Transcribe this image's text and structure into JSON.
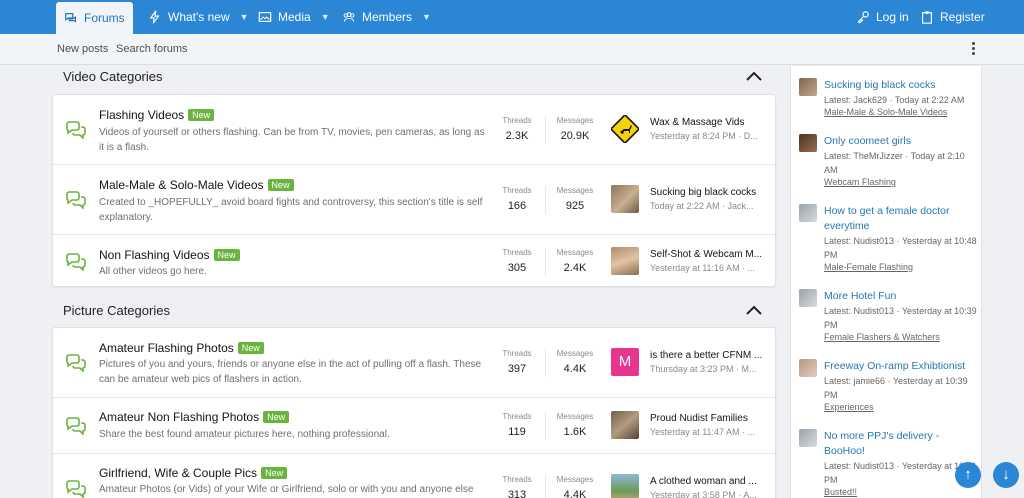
{
  "nav": {
    "forums": "Forums",
    "whats_new": "What's new",
    "media": "Media",
    "members": "Members",
    "login": "Log in",
    "register": "Register"
  },
  "subnav": {
    "new_posts": "New posts",
    "search_forums": "Search forums"
  },
  "categories": [
    {
      "title": "Video Categories",
      "nodes": [
        {
          "title": "Flashing Videos",
          "badge": "New",
          "desc": "Videos of yourself or others flashing. Can be from TV, movies, pen cameras, as long as it is a flash.",
          "threads_label": "Threads",
          "threads": "2.3K",
          "messages_label": "Messages",
          "messages": "20.9K",
          "last_title": "Wax & Massage Vids",
          "last_meta": "Yesterday at 8:24 PM · D..."
        },
        {
          "title": "Male-Male & Solo-Male Videos",
          "badge": "New",
          "desc": "Created to _HOPEFULLY_ avoid board fights and controversy, this section's title is self explanatory.",
          "threads_label": "Threads",
          "threads": "166",
          "messages_label": "Messages",
          "messages": "925",
          "last_title": "Sucking big black cocks",
          "last_meta": "Today at 2:22 AM · Jack..."
        },
        {
          "title": "Non Flashing Videos",
          "badge": "New",
          "desc": "All other videos go here.",
          "threads_label": "Threads",
          "threads": "305",
          "messages_label": "Messages",
          "messages": "2.4K",
          "last_title": "Self-Shot & Webcam M...",
          "last_meta": "Yesterday at 11:16 AM · ..."
        }
      ]
    },
    {
      "title": "Picture Categories",
      "nodes": [
        {
          "title": "Amateur Flashing Photos",
          "badge": "New",
          "desc": "Pictures of you and yours, friends or anyone else in the act of pulling off a flash. These can be amateur web pics of flashers in action.",
          "threads_label": "Threads",
          "threads": "397",
          "messages_label": "Messages",
          "messages": "4.4K",
          "last_title": "is there a better CFNM ...",
          "last_meta": "Thursday at 3:23 PM · M...",
          "avatar_letter": "M"
        },
        {
          "title": "Amateur Non Flashing Photos",
          "badge": "New",
          "desc": "Share the best found amateur pictures here, nothing professional.",
          "threads_label": "Threads",
          "threads": "119",
          "messages_label": "Messages",
          "messages": "1.6K",
          "last_title": "Proud Nudist Families",
          "last_meta": "Yesterday at 11:47 AM · ..."
        },
        {
          "title": "Girlfriend, Wife & Couple Pics",
          "badge": "New",
          "desc": "Amateur Photos (or Vids) of your Wife or Girlfriend, solo or with you and anyone else",
          "threads_label": "Threads",
          "threads": "313",
          "messages_label": "Messages",
          "messages": "4.4K",
          "last_title": "A clothed woman and ...",
          "last_meta": "Yesterday at 3:58 PM · A..."
        }
      ]
    }
  ],
  "sidebar": [
    {
      "title": "Sucking big black cocks",
      "meta": "Latest: Jack629 · Today at 2:22 AM",
      "forum": "Male-Male & Solo-Male Videos"
    },
    {
      "title": "Only coomeet girls",
      "meta": "Latest: TheMrJizzer · Today at 2:10 AM",
      "forum": "Webcam Flashing"
    },
    {
      "title": "How to get a female doctor everytime",
      "meta": "Latest: Nudist013 · Yesterday at 10:48 PM",
      "forum": "Male-Female Flashing"
    },
    {
      "title": "More Hotel Fun",
      "meta": "Latest: Nudist013 · Yesterday at 10:39 PM",
      "forum": "Female Flashers & Watchers"
    },
    {
      "title": "Freeway On-ramp Exhibtionist",
      "meta": "Latest: jamie66 · Yesterday at 10:39 PM",
      "forum": "Experiences"
    },
    {
      "title": "No more PPJ's delivery - BooHoo!",
      "meta": "Latest: Nudist013 · Yesterday at 10:31 PM",
      "forum": "Busted!!"
    }
  ],
  "colors": {
    "brand": "#2b87d6",
    "link": "#2577b1",
    "badge": "#6ab33e"
  }
}
